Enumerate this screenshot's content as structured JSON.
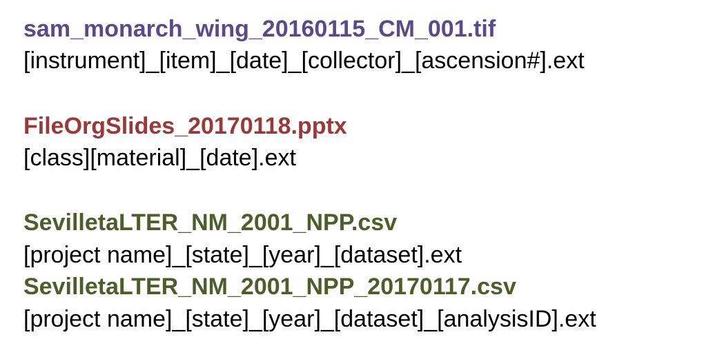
{
  "colors": {
    "purple": "#5b4a8a",
    "red": "#9b3838",
    "green": "#4e5e2a",
    "black": "#000000"
  },
  "examples": [
    {
      "filename": "sam_monarch_wing_20160115_CM_001.tif",
      "pattern": "[instrument]_[item]_[date]_[collector]_[ascension#].ext"
    },
    {
      "filename": "FileOrgSlides_20170118.pptx",
      "pattern": "[class][material]_[date].ext"
    },
    {
      "filename": "SevilletaLTER_NM_2001_NPP.csv",
      "pattern": "[project name]_[state]_[year]_[dataset].ext"
    },
    {
      "filename": "SevilletaLTER_NM_2001_NPP_20170117.csv",
      "pattern": "[project name]_[state]_[year]_[dataset]_[analysisID].ext"
    }
  ]
}
